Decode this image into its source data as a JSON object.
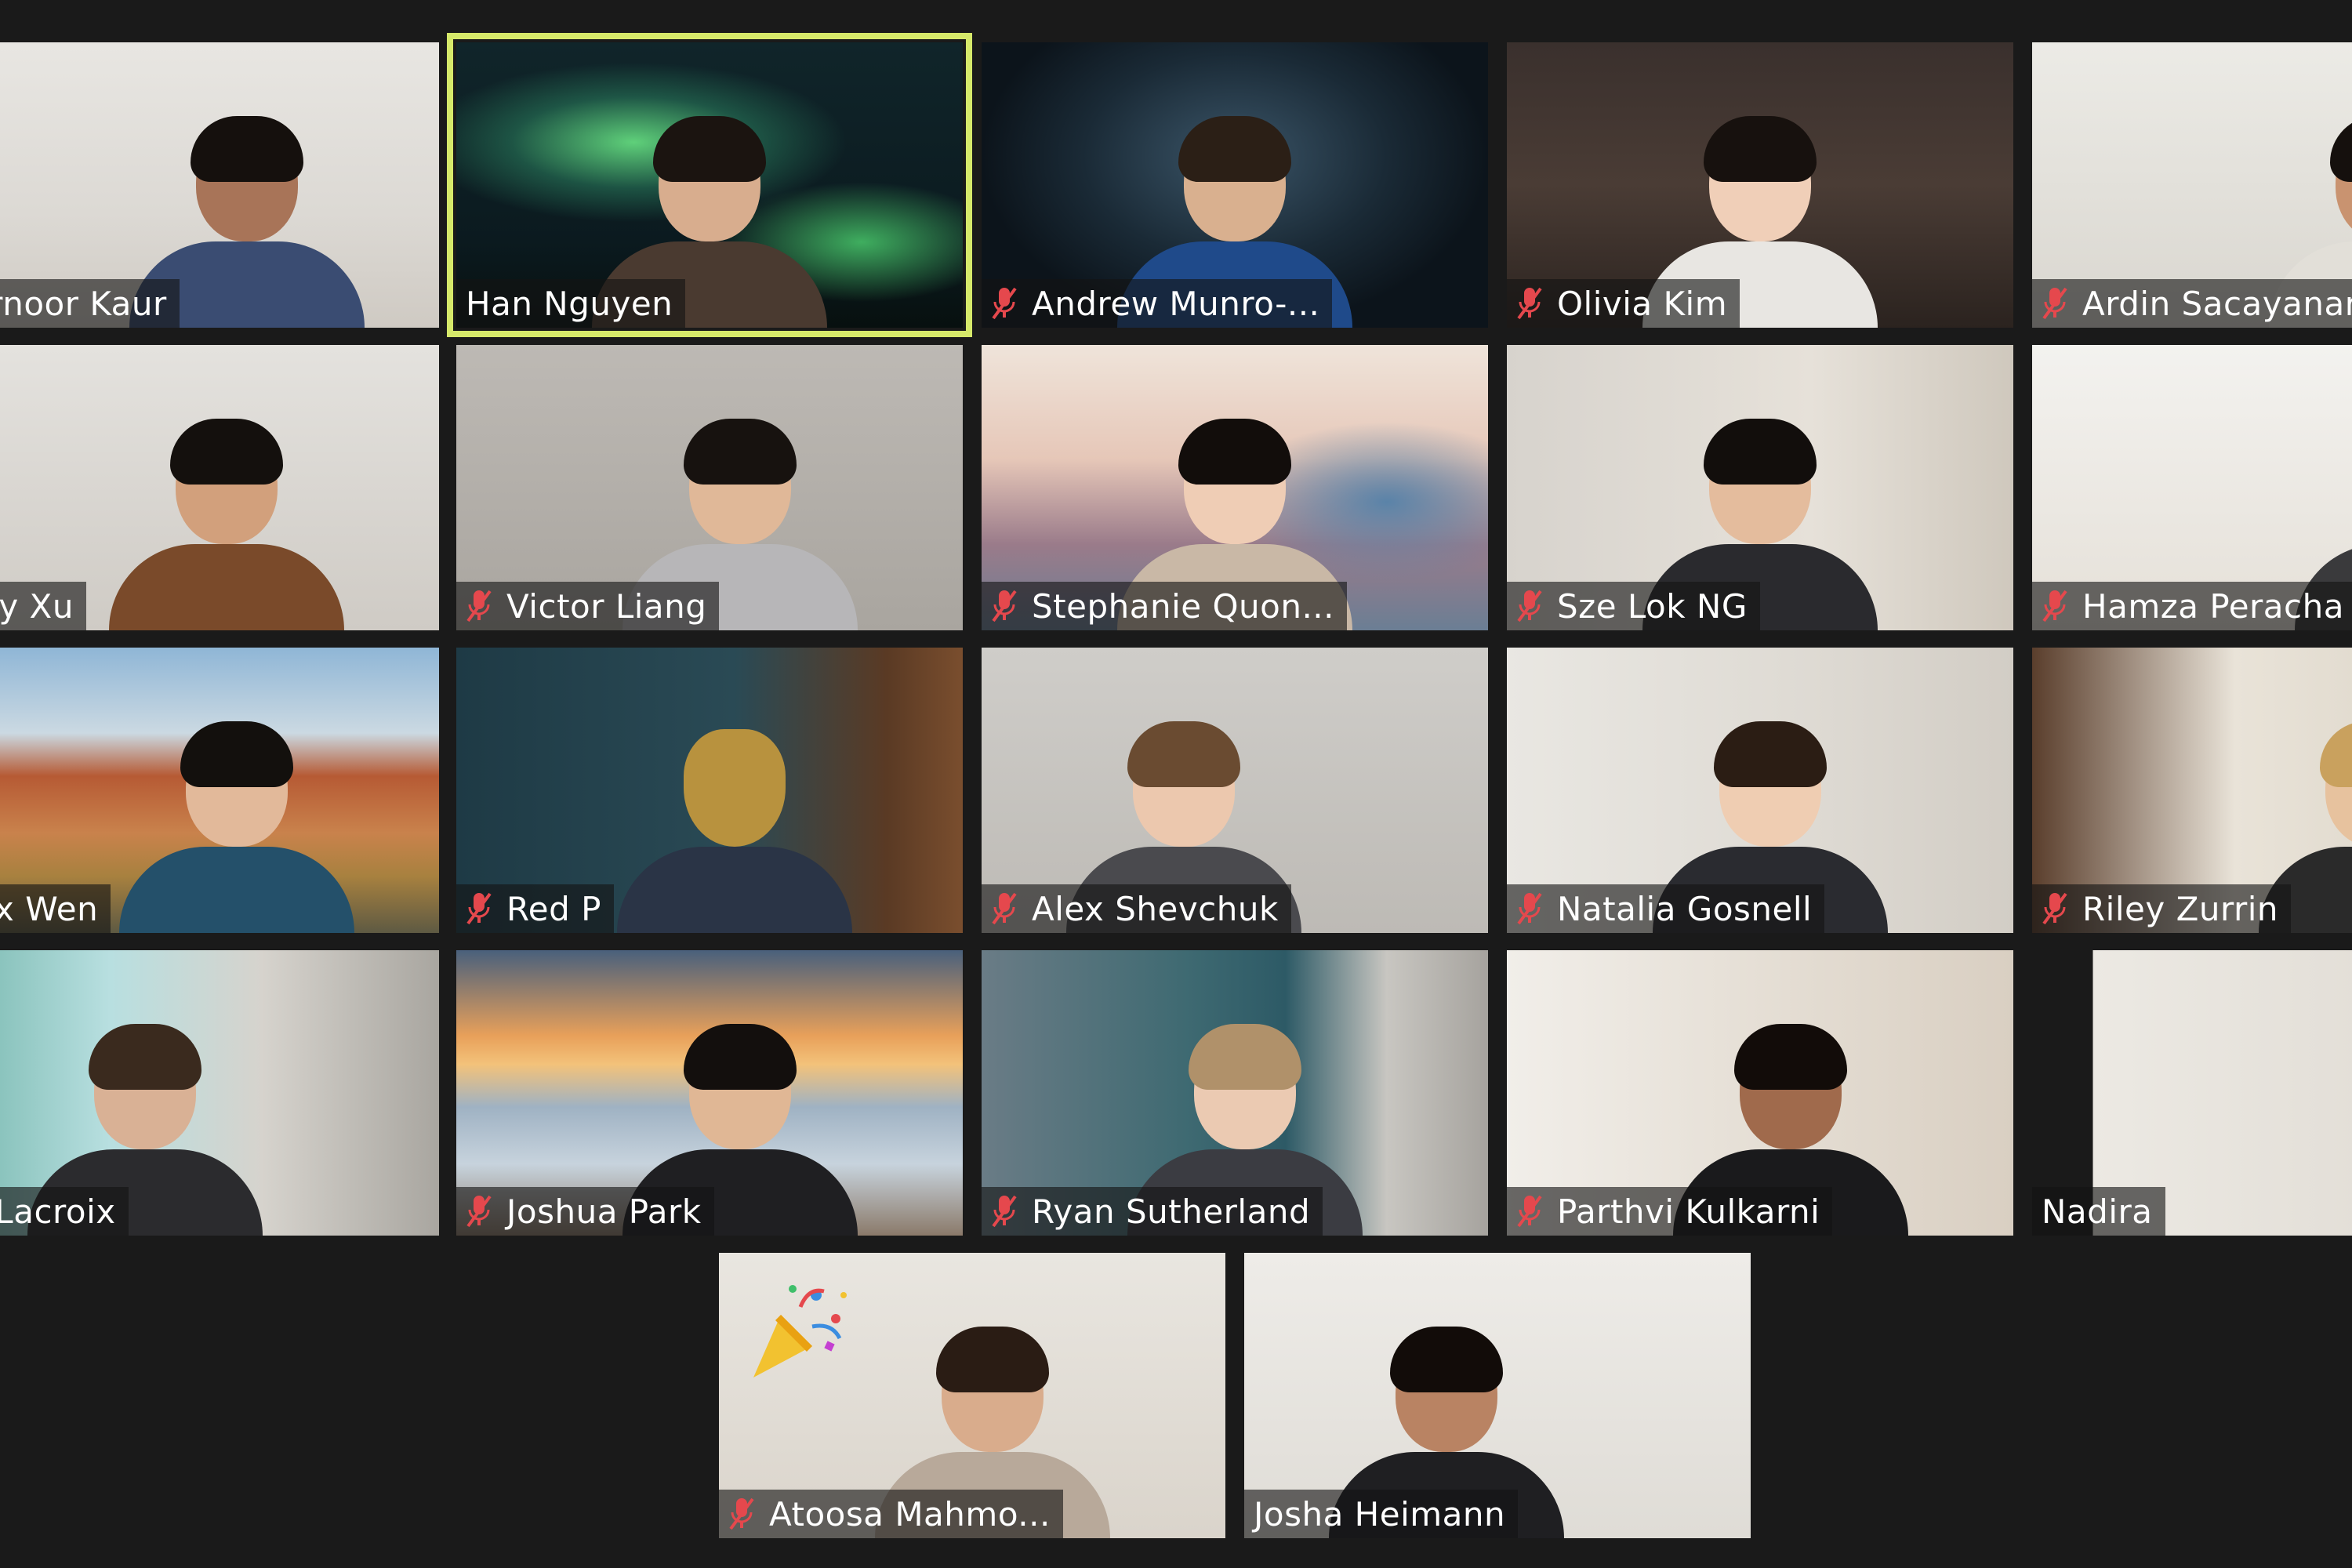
{
  "meeting": {
    "participants": [
      {
        "name": "Gurnoor Kaur",
        "muted": false
      },
      {
        "name": "Han Nguyen",
        "muted": false,
        "active_speaker": true
      },
      {
        "name": "Andrew Munro-...",
        "muted": true
      },
      {
        "name": "Olivia Kim",
        "muted": true
      },
      {
        "name": "Ardin Sacayanar",
        "muted": true
      },
      {
        "name": "Tony Xu",
        "muted": false
      },
      {
        "name": "Victor Liang",
        "muted": true
      },
      {
        "name": "Stephanie Quon...",
        "muted": true
      },
      {
        "name": "Sze Lok NG",
        "muted": true
      },
      {
        "name": "Hamza Peracha",
        "muted": true
      },
      {
        "name": "Alex Wen",
        "muted": false
      },
      {
        "name": "Red P",
        "muted": true
      },
      {
        "name": "Alex Shevchuk",
        "muted": true
      },
      {
        "name": "Natalia Gosnell",
        "muted": true
      },
      {
        "name": "Riley Zurrin",
        "muted": true
      },
      {
        "name": "en Lacroix",
        "muted": false
      },
      {
        "name": "Joshua Park",
        "muted": true
      },
      {
        "name": "Ryan Sutherland",
        "muted": true
      },
      {
        "name": "Parthvi Kulkarni",
        "muted": true
      },
      {
        "name": "Nadira",
        "muted": false
      },
      {
        "name": "Atoosa Mahmo...",
        "muted": true,
        "reaction": "party-popper-icon"
      },
      {
        "name": "Josha Heimann",
        "muted": false
      }
    ]
  },
  "colors": {
    "background": "#1a1a1a",
    "active_speaker_border": "#d6e96a",
    "mute_icon": "#e5484d",
    "label_text": "#ffffff"
  }
}
